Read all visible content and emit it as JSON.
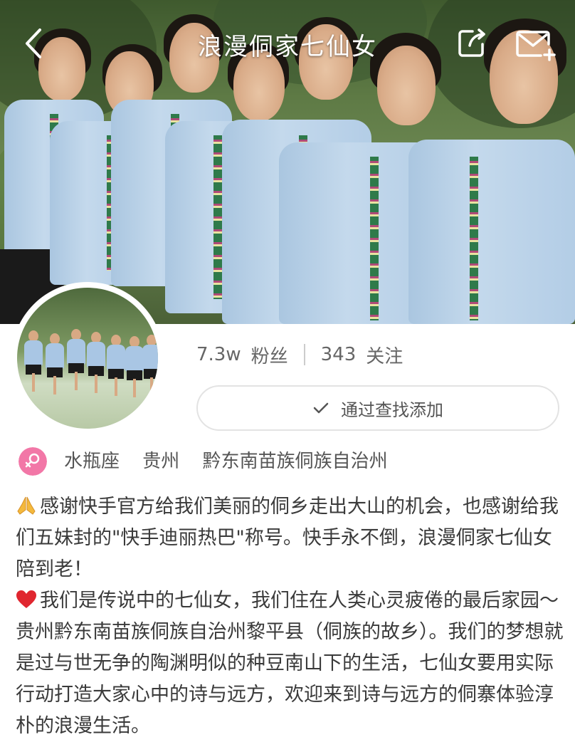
{
  "header": {
    "title": "浪漫侗家七仙女",
    "back_icon": "chevron-left-icon",
    "share_icon": "share-icon",
    "message_icon": "mail-add-icon"
  },
  "profile": {
    "followers": "7.3w",
    "followers_label": "粉丝",
    "following": "343",
    "following_label": "关注",
    "add_button_label": "通过查找添加",
    "gender_icon": "female-icon",
    "zodiac": "水瓶座",
    "province": "贵州",
    "region": "黔东南苗族侗族自治州"
  },
  "bio": {
    "paragraph1": "感谢快手官方给我们美丽的侗乡走出大山的机会，也感谢给我们五妹封的\"快手迪丽热巴\"称号。快手永不倒，浪漫侗家七仙女陪到老！",
    "paragraph2": "我们是传说中的七仙女，我们住在人类心灵疲倦的最后家园～贵州黔东南苗族侗族自治州黎平县（侗族的故乡）。我们的梦想就是过与世无争的陶渊明似的种豆南山下的生活，七仙女要用实际行动打造大家心中的诗与远方，欢迎来到诗与远方的侗寨体验淳朴的浪漫生活。",
    "emoji1": "pray-hands-icon",
    "emoji2": "red-heart-icon"
  },
  "colors": {
    "accent_pink": "#f277a7",
    "text_primary": "#3a3a3a",
    "text_secondary": "#666666"
  }
}
